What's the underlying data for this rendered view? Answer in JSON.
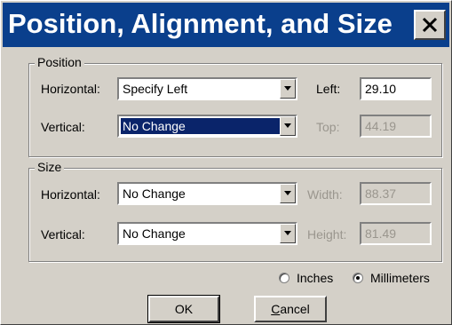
{
  "window": {
    "title": "Position, Alignment, and Size",
    "close_icon": "close-icon"
  },
  "position": {
    "group_label": "Position",
    "horizontal": {
      "label": "Horizontal:",
      "value": "Specify Left"
    },
    "vertical": {
      "label": "Vertical:",
      "value": "No Change"
    },
    "left": {
      "label": "Left:",
      "value": "29.10"
    },
    "top": {
      "label": "Top:",
      "value": "44.19"
    }
  },
  "size": {
    "group_label": "Size",
    "horizontal": {
      "label": "Horizontal:",
      "value": "No Change"
    },
    "vertical": {
      "label": "Vertical:",
      "value": "No Change"
    },
    "width": {
      "label": "Width:",
      "value": "88.37"
    },
    "height": {
      "label": "Height:",
      "value": "81.49"
    }
  },
  "units": {
    "inches": {
      "label": "Inches",
      "checked": false
    },
    "millimeters": {
      "label": "Millimeters",
      "checked": true
    }
  },
  "buttons": {
    "ok": "OK",
    "cancel_first": "C",
    "cancel_rest": "ancel"
  },
  "colors": {
    "title_bar": "#0a3f8c",
    "dialog_face": "#d4d0c8",
    "selection": "#0a246a"
  }
}
